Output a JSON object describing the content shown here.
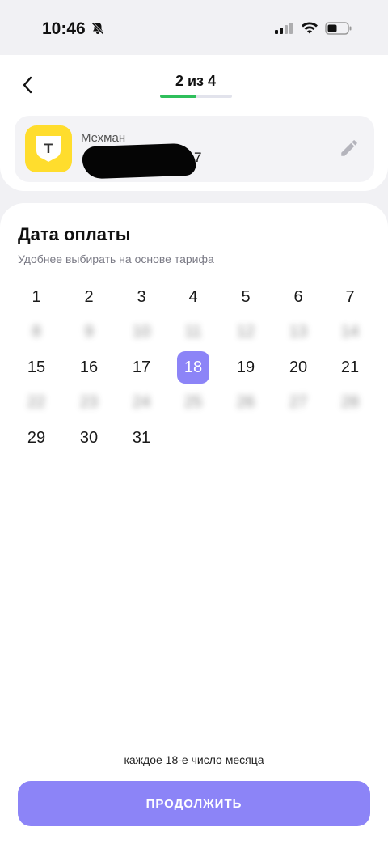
{
  "status_bar": {
    "time": "10:46",
    "icons": [
      "bell-slash-icon",
      "signal-icon",
      "wifi-icon",
      "battery-icon"
    ]
  },
  "header": {
    "step_label": "2 из 4",
    "progress": 0.5,
    "progress_color": "#2fbf5b"
  },
  "account": {
    "name": "Мехман",
    "number_suffix": "7",
    "logo_color": "#ffdd2d",
    "logo_letter": "T"
  },
  "calendar": {
    "title": "Дата оплаты",
    "subtitle": "Удобнее выбирать на основе тарифа",
    "selected_day": 18,
    "days": [
      "1",
      "2",
      "3",
      "4",
      "5",
      "6",
      "7",
      "8",
      "9",
      "10",
      "11",
      "12",
      "13",
      "14",
      "15",
      "16",
      "17",
      "18",
      "19",
      "20",
      "21",
      "22",
      "23",
      "24",
      "25",
      "26",
      "27",
      "28",
      "29",
      "30",
      "31"
    ],
    "blurred_rows": [
      1,
      3
    ],
    "accent_color": "#8c84f7"
  },
  "footer": {
    "hint": "каждое 18-е число месяца",
    "continue_label": "ПРОДОЛЖИТЬ"
  }
}
